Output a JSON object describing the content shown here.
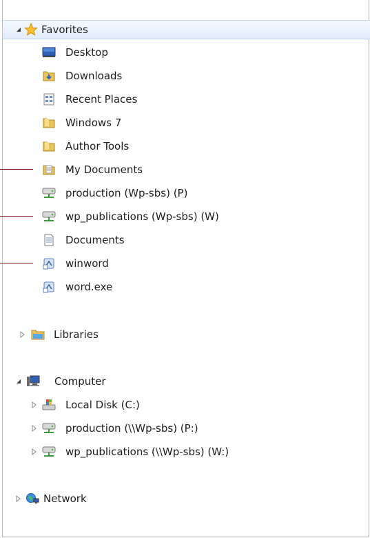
{
  "favorites": {
    "label": "Favorites",
    "items": [
      {
        "label": "Desktop",
        "icon": "desktop-icon"
      },
      {
        "label": "Downloads",
        "icon": "downloads-folder-icon"
      },
      {
        "label": "Recent Places",
        "icon": "recent-places-icon"
      },
      {
        "label": "Windows 7",
        "icon": "folder-icon"
      },
      {
        "label": "Author Tools",
        "icon": "folder-icon"
      },
      {
        "label": "My Documents",
        "icon": "documents-folder-icon"
      },
      {
        "label": "production (Wp-sbs) (P)",
        "icon": "network-drive-icon"
      },
      {
        "label": "wp_publications (Wp-sbs) (W)",
        "icon": "network-drive-icon"
      },
      {
        "label": "Documents",
        "icon": "document-icon"
      },
      {
        "label": "winword",
        "icon": "shortcut-icon"
      },
      {
        "label": "word.exe",
        "icon": "shortcut-icon"
      }
    ]
  },
  "libraries": {
    "label": "Libraries"
  },
  "computer": {
    "label": "Computer",
    "items": [
      {
        "label": "Local Disk (C:)",
        "icon": "local-disk-icon"
      },
      {
        "label": "production (\\\\Wp-sbs) (P:)",
        "icon": "network-drive-icon"
      },
      {
        "label": "wp_publications (\\\\Wp-sbs) (W:)",
        "icon": "network-drive-icon"
      }
    ]
  },
  "network": {
    "label": "Network"
  },
  "colors": {
    "selection": "#e2edfc",
    "callout_line": "#7b1b1b",
    "folder": "#e8c25a"
  }
}
